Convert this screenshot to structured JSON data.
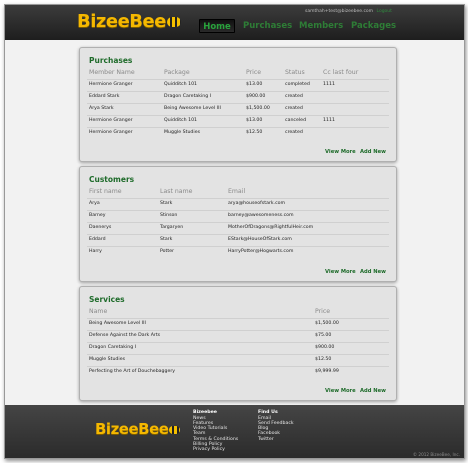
{
  "header": {
    "logo": "BizeeBee",
    "user_email": "samthah+test@bizeebee.com",
    "logout": "Logout",
    "nav": [
      "Home",
      "Purchases",
      "Members",
      "Packages"
    ]
  },
  "purchases": {
    "title": "Purchases",
    "columns": [
      "Member Name",
      "Package",
      "Price",
      "Status",
      "Cc last four"
    ],
    "rows": [
      [
        "Hermione Granger",
        "Quidditch 101",
        "$13.00",
        "completed",
        "1111"
      ],
      [
        "Eddard Stark",
        "Dragon Caretaking I",
        "$900.00",
        "created",
        ""
      ],
      [
        "Arya Stark",
        "Being Awesome Level III",
        "$1,500.00",
        "created",
        ""
      ],
      [
        "Hermione Granger",
        "Quidditch 101",
        "$13.00",
        "canceled",
        "1111"
      ],
      [
        "Hermione Granger",
        "Muggle Studies",
        "$12.50",
        "created",
        ""
      ]
    ],
    "view_more": "View More",
    "add_new": "Add New"
  },
  "customers": {
    "title": "Customers",
    "columns": [
      "First name",
      "Last name",
      "Email"
    ],
    "rows": [
      [
        "Arya",
        "Stark",
        "arya@houseofstark.com"
      ],
      [
        "Barney",
        "Stinson",
        "barney@awesomeness.com"
      ],
      [
        "Daenerys",
        "Targaryen",
        "MotherOfDragons@RightfulHeir.com"
      ],
      [
        "Eddard",
        "Stark",
        "EStark@HouseOfStark.com"
      ],
      [
        "Harry",
        "Potter",
        "HarryPotter@Hogwarts.com"
      ]
    ],
    "view_more": "View More",
    "add_new": "Add New"
  },
  "services": {
    "title": "Services",
    "columns": [
      "Name",
      "Price"
    ],
    "rows": [
      [
        "Being Awesome Level III",
        "$1,500.00"
      ],
      [
        "Defense Against the Dark Arts",
        "$75.00"
      ],
      [
        "Dragon Caretaking I",
        "$900.00"
      ],
      [
        "Muggle Studies",
        "$12.50"
      ],
      [
        "Perfecting the Art of Douchebaggery",
        "$9,999.99"
      ]
    ],
    "view_more": "View More",
    "add_new": "Add New"
  },
  "footer": {
    "logo": "BizeeBee",
    "col1_title": "Bizeebee",
    "col1_items": [
      "News",
      "Features",
      "Video Tutorials",
      "Team",
      "Terms & Conditions",
      "Billing Policy",
      "Privacy Policy"
    ],
    "col2_title": "Find Us",
    "col2_items": [
      "Email",
      "Send Feedback",
      "Blog",
      "Facebook",
      "Twitter"
    ],
    "copyright": "© 2012 BizeeBee, Inc."
  },
  "colors": {
    "accent_green": "#1e6b2a",
    "logo_yellow": "#f5b800",
    "header_dark": "#2a2a2a"
  }
}
